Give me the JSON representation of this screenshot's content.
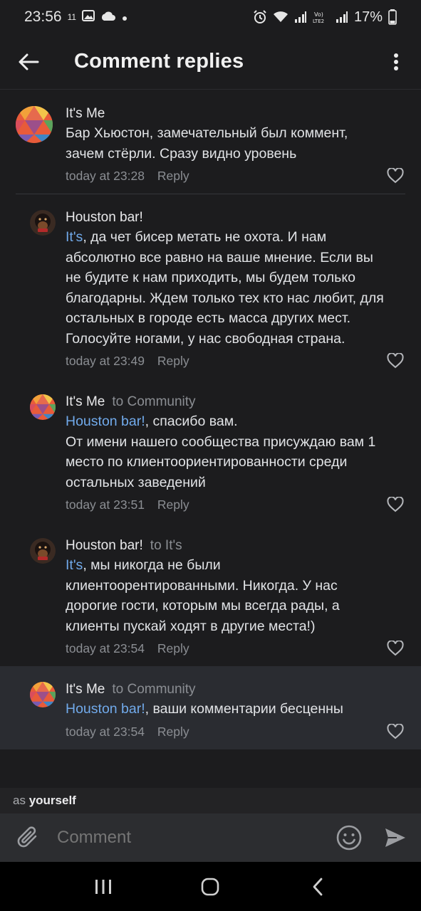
{
  "status": {
    "time": "23:56",
    "temp": "11",
    "battery": "17%"
  },
  "header": {
    "title": "Comment replies"
  },
  "comments": [
    {
      "author": "It's Me",
      "to": "",
      "mention": "",
      "text": "Бар Хьюстон, замечательный был коммент, зачем стёрли. Сразу видно уровень",
      "time": "today at 23:28",
      "reply": "Reply"
    },
    {
      "author": "Houston bar!",
      "to": "",
      "mention": "It's",
      "text": ", да чет бисер метать не охота. И нам абсолютно все равно на ваше мнение. Если вы не будите к нам приходить, мы будем только благодарны. Ждем только тех кто нас любит, для остальных в городе есть масса других мест. Голосуйте ногами, у нас свободная страна.",
      "time": "today at 23:49",
      "reply": "Reply"
    },
    {
      "author": "It's Me",
      "to": "to Community",
      "mention": "Houston bar!",
      "text": ", спасибо вам.\nОт имени нашего сообщества присуждаю вам 1 место по клиентоориентированности среди остальных заведений",
      "time": "today at 23:51",
      "reply": "Reply"
    },
    {
      "author": "Houston bar!",
      "to": "to It's",
      "mention": "It's",
      "text": ", мы никогда не были клиентоорентированными. Никогда. У нас дорогие гости, которым мы всегда рады, а клиенты пускай ходят в другие места!)",
      "time": "today at 23:54",
      "reply": "Reply"
    },
    {
      "author": "It's Me",
      "to": "to Community",
      "mention": "Houston bar!",
      "text": ", ваши комментарии бесценны",
      "time": "today at 23:54",
      "reply": "Reply"
    }
  ],
  "composer": {
    "as_label": "as",
    "as_value": "yourself",
    "placeholder": "Comment"
  },
  "colors": {
    "background": "#1c1c1e",
    "highlight": "#2a2c31",
    "mention": "#71aaeb",
    "secondary_text": "#8b8e93"
  }
}
